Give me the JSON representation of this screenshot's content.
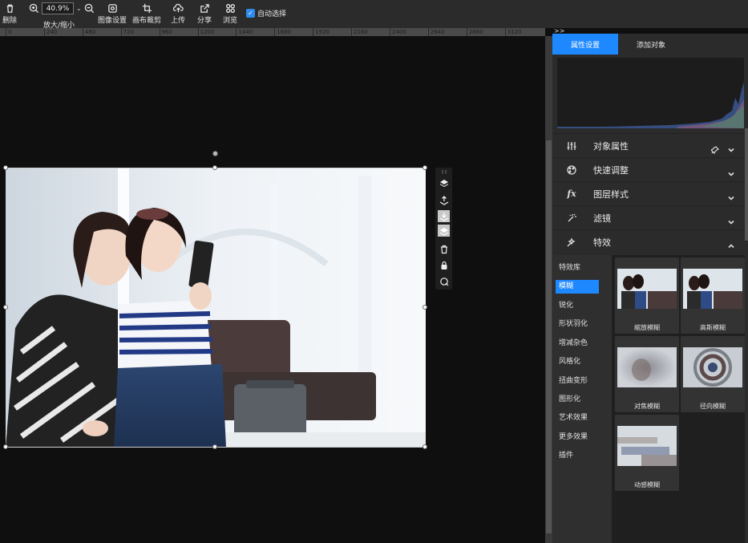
{
  "toolbar": {
    "delete_label": "删除",
    "zoom_value": "40.9%",
    "zoom_label": "放大/缩小",
    "image_settings_label": "图像设置",
    "canvas_crop_label": "画布裁剪",
    "upload_label": "上传",
    "share_label": "分享",
    "browse_label": "浏览",
    "auto_select_label": "自动选择",
    "auto_select_checked": true
  },
  "ruler": {
    "ticks": [
      "0",
      "240",
      "480",
      "720",
      "960",
      "1200",
      "1440",
      "1680",
      "1920",
      "2160",
      "2400",
      "2640",
      "2880",
      "3120"
    ]
  },
  "panel": {
    "collapse_arrow": ">>",
    "tabs": [
      "属性设置",
      "添加对象"
    ],
    "active_tab": "属性设置",
    "sections": [
      {
        "label": "对象属性",
        "icon": "sliders-icon",
        "expanded": false
      },
      {
        "label": "快速调整",
        "icon": "palette-icon",
        "expanded": false
      },
      {
        "label": "图层样式",
        "icon": "fx-icon",
        "expanded": false
      },
      {
        "label": "滤镜",
        "icon": "magic-wand-icon",
        "expanded": false
      },
      {
        "label": "特效",
        "icon": "effects-wand-icon",
        "expanded": true
      }
    ],
    "effect_categories": [
      "特效库",
      "模糊",
      "锐化",
      "形状羽化",
      "增减杂色",
      "风格化",
      "扭曲变形",
      "图形化",
      "艺术效果",
      "更多效果",
      "插件"
    ],
    "selected_category": "模糊",
    "effects": [
      "缩放模糊",
      "高斯模糊",
      "对焦模糊",
      "径向模糊",
      "动感模糊"
    ]
  },
  "colors": {
    "accent": "#1e88ff",
    "toolbar_bg": "#2b2b2b",
    "canvas_bg": "#0f0f10"
  }
}
